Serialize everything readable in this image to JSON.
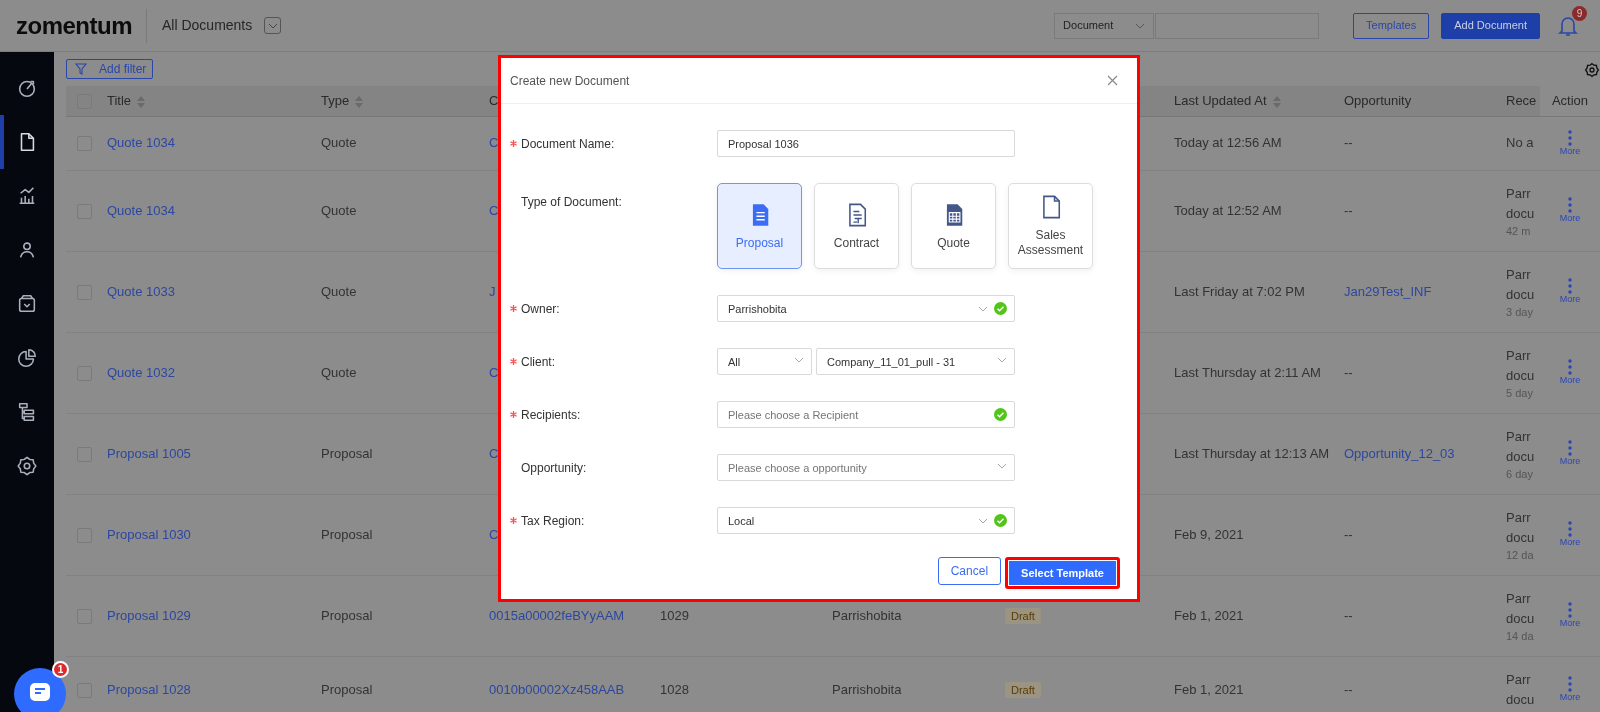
{
  "header": {
    "logo": "zomentum",
    "view_title": "All Documents",
    "search_scope": "Document",
    "buttons": [
      {
        "label": "Templates",
        "kind": "outline"
      },
      {
        "label": "Add Document",
        "kind": "primary"
      }
    ],
    "notification_count": "9"
  },
  "sidebar": {
    "items": [
      {
        "selected": false
      },
      {
        "selected": true
      },
      {
        "selected": false
      },
      {
        "selected": false
      },
      {
        "selected": false
      },
      {
        "selected": false
      },
      {
        "selected": false
      },
      {
        "selected": false
      }
    ]
  },
  "toolbar": {
    "filter_button": "Add filter"
  },
  "table": {
    "select_all_checked": false,
    "columns": [
      {
        "kind": "label",
        "label": "Title",
        "sortable": true
      },
      {
        "kind": "label",
        "label": "Type",
        "sortable": true
      },
      {
        "kind": "label",
        "label": "C"
      },
      {
        "kind": "hidden"
      },
      {
        "kind": "hidden"
      },
      {
        "kind": "hidden"
      },
      {
        "kind": "label",
        "label": "Last Updated At",
        "sortable": true
      },
      {
        "kind": "label",
        "label": "Opportunity"
      },
      {
        "kind": "label",
        "label": "Rece"
      },
      {
        "kind": "label",
        "label": "Action"
      }
    ],
    "rows": [
      {
        "checked": false,
        "title": "Quote 1034",
        "type": "Quote",
        "column_3": "C",
        "last_updated": "Today at 12:56 AM",
        "opportunity": {
          "text": "--",
          "kind": "plain"
        },
        "recent": {
          "lines": [
            "No a"
          ]
        },
        "action": "More"
      },
      {
        "checked": false,
        "title": "Quote 1034",
        "type": "Quote",
        "column_3": "C",
        "last_updated": "Today at 12:52 AM",
        "opportunity": {
          "text": "--",
          "kind": "plain"
        },
        "recent": {
          "lines": [
            "Parr",
            "docu"
          ],
          "time": "42 m"
        },
        "action": "More"
      },
      {
        "checked": false,
        "title": "Quote 1033",
        "type": "Quote",
        "column_3": "J",
        "last_updated": "Last Friday at 7:02 PM",
        "opportunity": {
          "text": "Jan29Test_INF",
          "kind": "link"
        },
        "recent": {
          "lines": [
            "Parr",
            "docu"
          ],
          "time": "3 day"
        },
        "action": "More"
      },
      {
        "checked": false,
        "title": "Quote 1032",
        "type": "Quote",
        "column_3": "C",
        "last_updated": "Last Thursday at 2:11 AM",
        "opportunity": {
          "text": "--",
          "kind": "plain"
        },
        "recent": {
          "lines": [
            "Parr",
            "docu"
          ],
          "time": "5 day"
        },
        "action": "More"
      },
      {
        "checked": false,
        "title": "Proposal 1005",
        "type": "Proposal",
        "column_3": "C",
        "last_updated": "Last Thursday at 12:13 AM",
        "opportunity": {
          "text": "Opportunity_12_03",
          "kind": "link"
        },
        "recent": {
          "lines": [
            "Parr",
            "docu"
          ],
          "time": "6 day"
        },
        "action": "More"
      },
      {
        "checked": false,
        "title": "Proposal 1030",
        "type": "Proposal",
        "column_3": "C",
        "last_updated": "Feb 9, 2021",
        "opportunity": {
          "text": "--",
          "kind": "plain"
        },
        "recent": {
          "lines": [
            "Parr",
            "docu"
          ],
          "time": "12 da"
        },
        "action": "More"
      },
      {
        "checked": false,
        "title": "Proposal 1029",
        "type": "Proposal",
        "column_3": "0015a00002feBYyAAM",
        "column_4": "1029",
        "column_5": "Parrishobita",
        "status": "Draft",
        "last_updated": "Feb 1, 2021",
        "opportunity": {
          "text": "--",
          "kind": "plain"
        },
        "recent": {
          "lines": [
            "Parr",
            "docu"
          ],
          "time": "14 da"
        },
        "action": "More"
      },
      {
        "checked": false,
        "title": "Proposal 1028",
        "type": "Proposal",
        "column_3": "0010b00002Xz458AAB",
        "column_4": "1028",
        "column_5": "Parrishobita",
        "status": "Draft",
        "last_updated": "Feb 1, 2021",
        "opportunity": {
          "text": "--",
          "kind": "plain"
        },
        "recent": {
          "lines": [
            "Parr",
            "docu"
          ]
        },
        "action": "More"
      }
    ]
  },
  "modal": {
    "title": "Create new Document",
    "highlighted": true,
    "fields": [
      {
        "kind": "text",
        "label": "Document Name:",
        "required": true,
        "value": "Proposal 1036"
      },
      {
        "kind": "cards",
        "label": "Type of Document:",
        "required": false,
        "options": [
          {
            "label": "Proposal",
            "selected": true
          },
          {
            "label": "Contract",
            "selected": false
          },
          {
            "label": "Quote",
            "selected": false
          },
          {
            "label": "Sales Assessment",
            "selected": false
          }
        ]
      },
      {
        "kind": "select",
        "label": "Owner:",
        "required": true,
        "value": "Parrishobita",
        "caret": true,
        "valid": true
      },
      {
        "kind": "select-pair",
        "label": "Client:",
        "required": true,
        "selects": [
          {
            "value": "All"
          },
          {
            "value": "Company_11_01_pull - 31"
          }
        ]
      },
      {
        "kind": "select",
        "label": "Recipients:",
        "required": true,
        "placeholder": "Please choose a Recipient",
        "caret": false,
        "valid": true
      },
      {
        "kind": "select",
        "label": "Opportunity:",
        "required": false,
        "placeholder": "Please choose a opportunity",
        "caret": true,
        "valid": false
      },
      {
        "kind": "select",
        "label": "Tax Region:",
        "required": true,
        "value": "Local",
        "caret": true,
        "valid": true
      }
    ],
    "buttons": [
      {
        "label": "Cancel",
        "kind": "outline",
        "highlighted": false
      },
      {
        "label": "Select Template",
        "kind": "primary",
        "highlighted": true
      }
    ]
  },
  "chat": {
    "badge": "1"
  }
}
